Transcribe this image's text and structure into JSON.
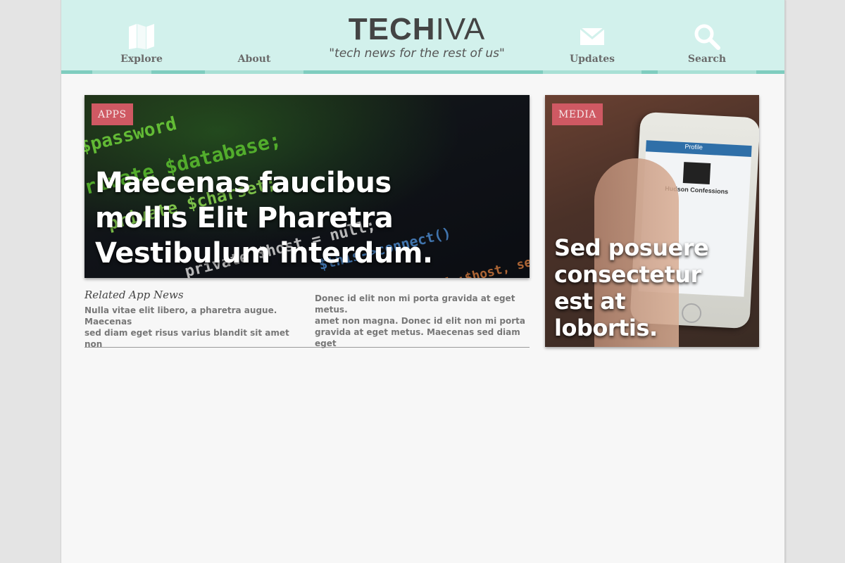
{
  "header": {
    "logo_bold": "TECH",
    "logo_thin": "IVA",
    "tagline": "\"tech news for the rest of us\"",
    "nav": {
      "explore": "Explore",
      "about": "About",
      "updates": "Updates",
      "search": "Search"
    }
  },
  "featured": {
    "badge": "APPS",
    "title": "Maecenas faucibus mollis Elit Pharetra Vestibulum interdum."
  },
  "side": {
    "badge": "MEDIA",
    "title": "Sed posuere consectetur est at lobortis.",
    "phone_screen_header": "Profile",
    "phone_account": "Hudson Confessions"
  },
  "related": {
    "heading": "Related App News",
    "left": [
      "Nulla vitae elit libero, a pharetra augue. Maecenas",
      "sed diam eget risus varius blandit sit amet non"
    ],
    "right": [
      "Donec id elit non mi porta gravida at eget metus.",
      "amet non magna. Donec id elit non mi porta gravida at eget metus. Maecenas sed diam eget"
    ]
  },
  "code_bg": [
    "$password",
    "private $database;",
    "private $charset;",
    "private $host = null;",
    "$this->connect()",
    "connect($self::$host, self::"
  ],
  "colors": {
    "header_bg": "#d2f1ec",
    "badge": "#cf5963",
    "page_bg": "#f7f7f7"
  }
}
